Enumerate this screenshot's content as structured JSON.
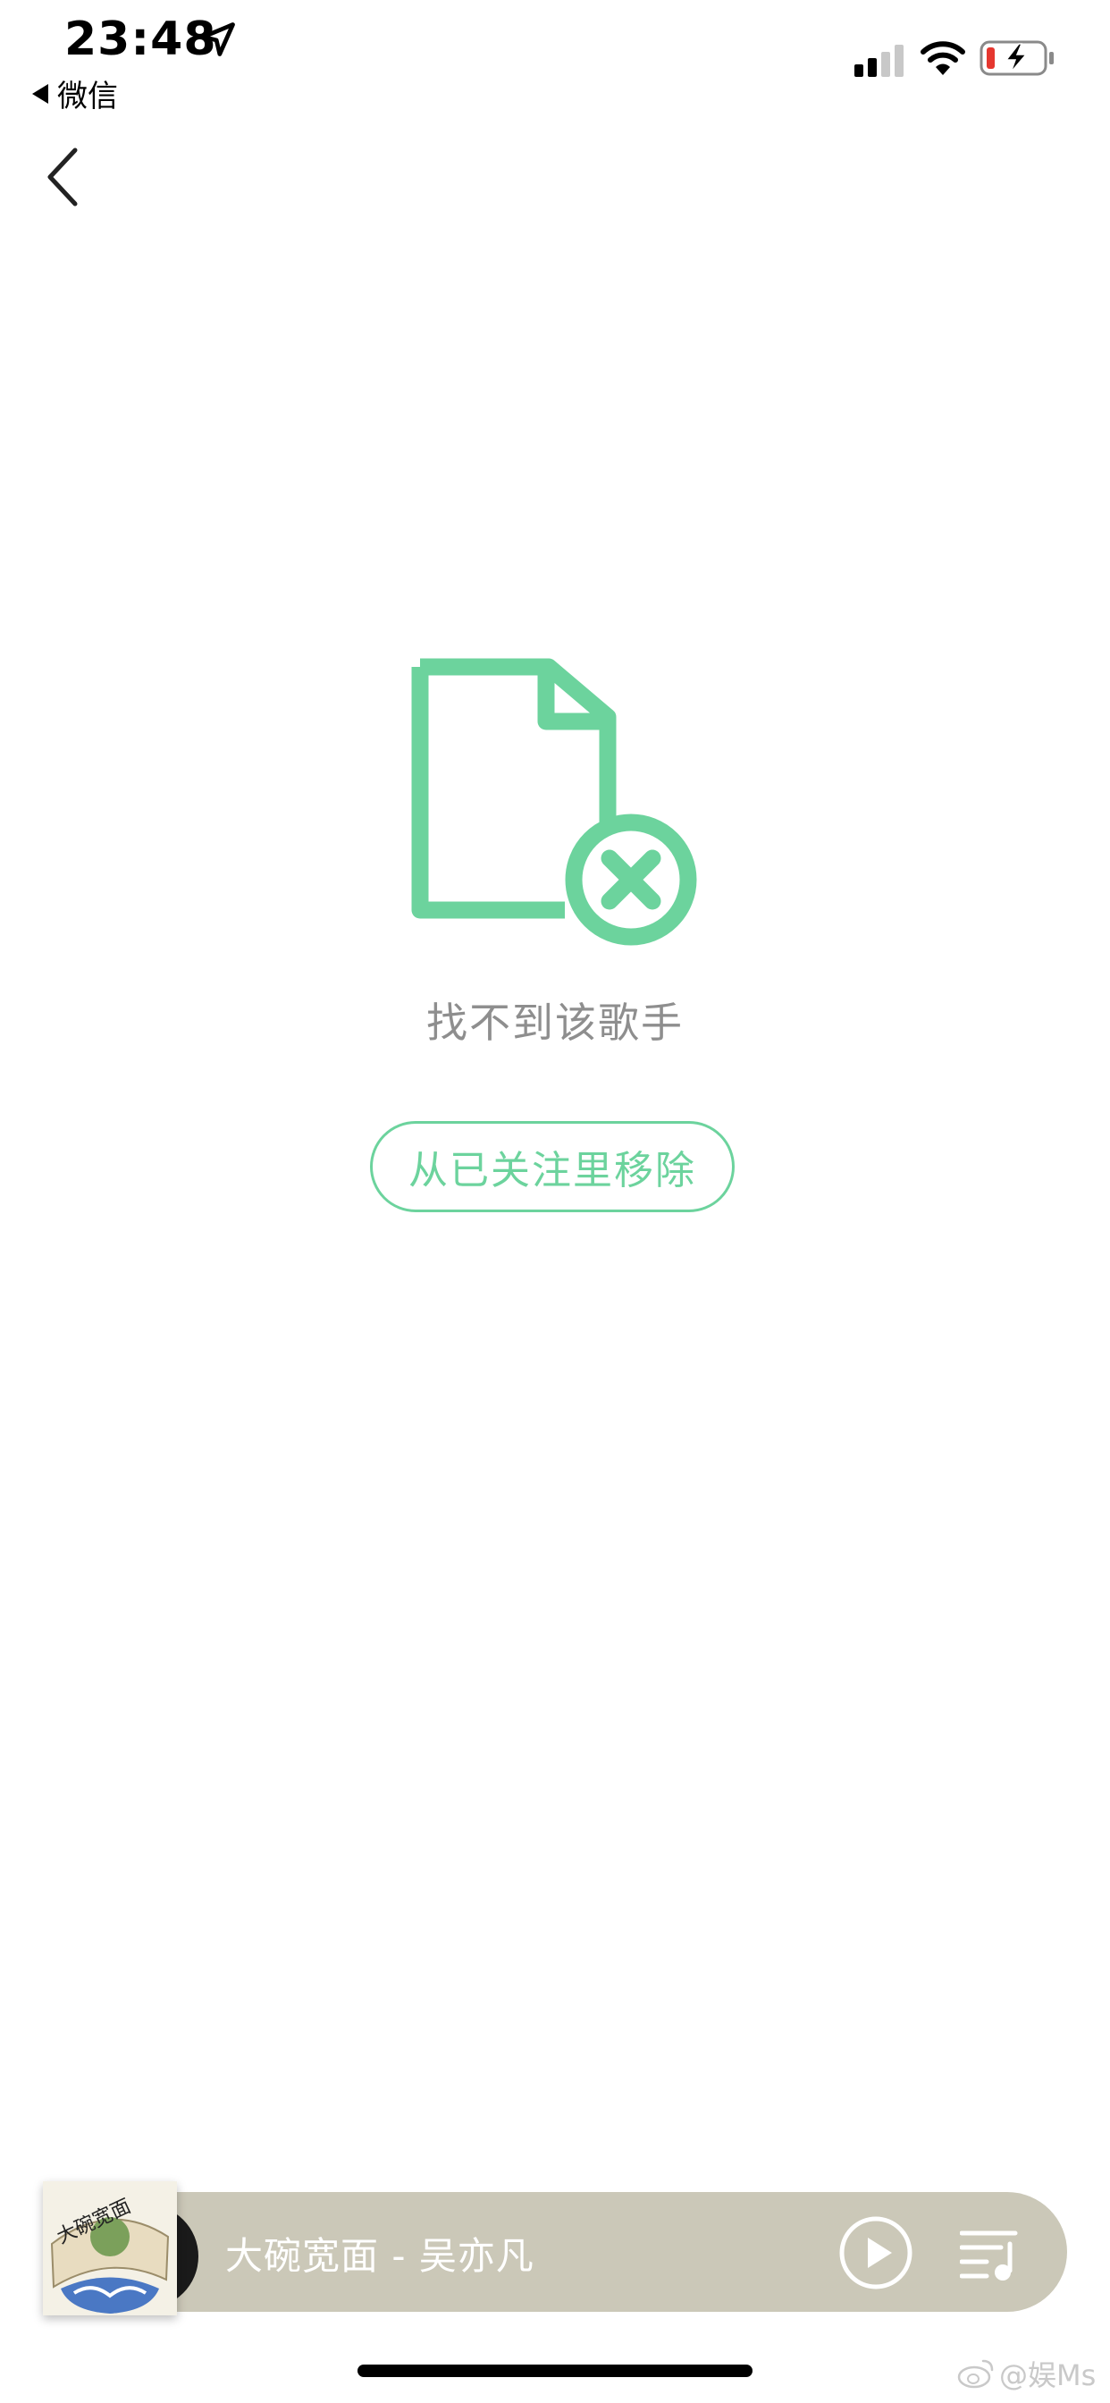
{
  "status_bar": {
    "time": "23:48",
    "back_app_label": "微信"
  },
  "empty_state": {
    "message": "找不到该歌手",
    "remove_button_label": "从已关注里移除",
    "icon": "file-error-icon"
  },
  "mini_player": {
    "track_title": "大碗宽面 - 吴亦凡",
    "album_art_text": "大碗宽面"
  },
  "watermark": {
    "text": "@娱Ms"
  },
  "colors": {
    "accent": "#6cd39d",
    "message_text": "#8e8e8e",
    "player_bg": "#cbc8b8"
  }
}
